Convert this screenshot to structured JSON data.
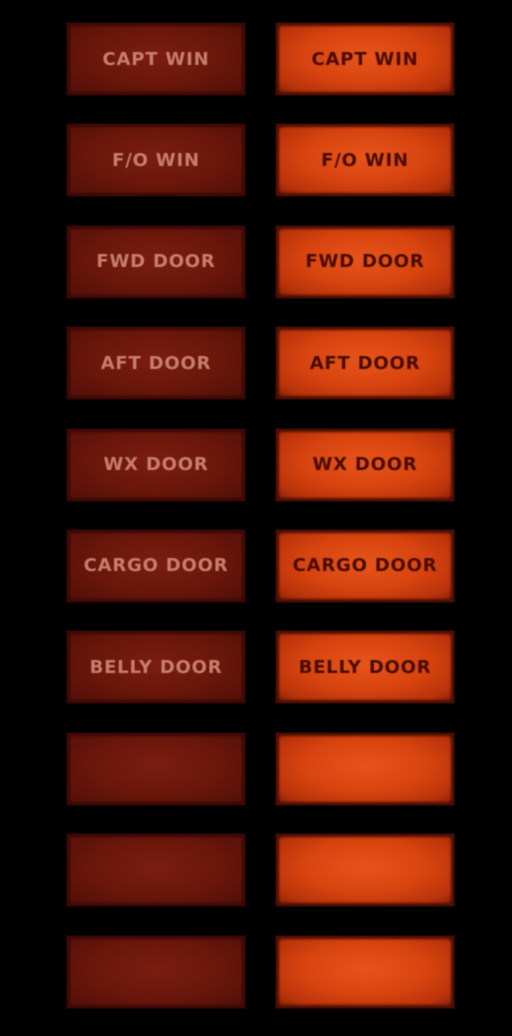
{
  "panel": {
    "title": "",
    "lights": [
      {
        "label": "CAPT WIN",
        "off_state": "dim",
        "on_state": "illuminated"
      },
      {
        "label": "F/O WIN",
        "off_state": "dim",
        "on_state": "illuminated"
      },
      {
        "label": "FWD DOOR",
        "off_state": "dim",
        "on_state": "illuminated"
      },
      {
        "label": "AFT DOOR",
        "off_state": "dim",
        "on_state": "illuminated"
      },
      {
        "label": "WX DOOR",
        "off_state": "dim",
        "on_state": "illuminated"
      },
      {
        "label": "CARGO DOOR",
        "off_state": "dim",
        "on_state": "illuminated"
      },
      {
        "label": "BELLY DOOR",
        "off_state": "dim",
        "on_state": "illuminated"
      },
      {
        "label": "",
        "off_state": "dim",
        "on_state": "illuminated"
      },
      {
        "label": "",
        "off_state": "dim",
        "on_state": "illuminated"
      },
      {
        "label": "",
        "off_state": "dim",
        "on_state": "illuminated"
      }
    ]
  },
  "colors": {
    "background": "#000000",
    "off_face": "#6a160b",
    "off_text": "#c77d6e",
    "on_face": "#d8440f",
    "on_text": "#4a0c04"
  }
}
